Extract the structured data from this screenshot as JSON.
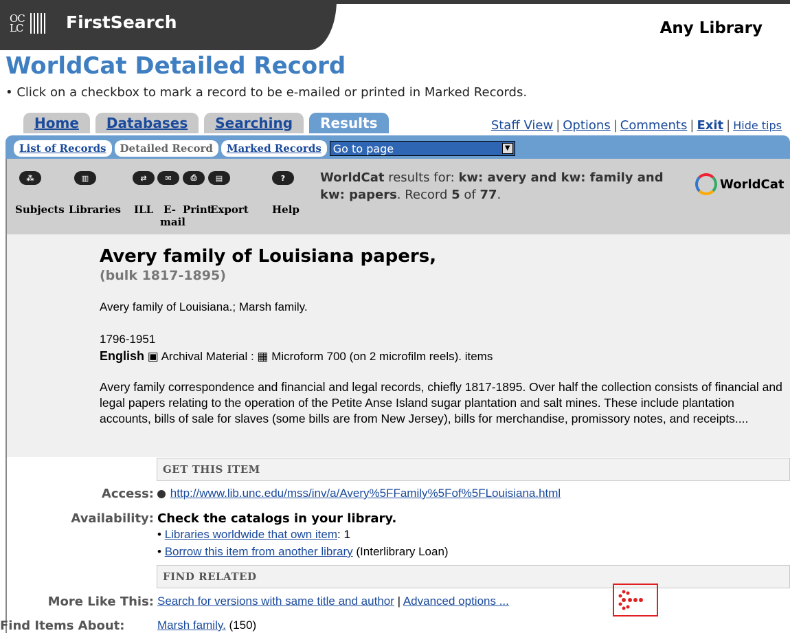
{
  "header": {
    "logo_letters": "OC LC",
    "app_name": "FirstSearch",
    "library": "Any Library"
  },
  "page": {
    "title": "WorldCat Detailed Record",
    "tip": "• Click on a checkbox to mark a record to be e-mailed or printed in Marked Records."
  },
  "tabs": [
    "Home",
    "Databases",
    "Searching",
    "Results"
  ],
  "top_links": {
    "staff_view": "Staff View",
    "options": "Options",
    "comments": "Comments",
    "exit": "Exit",
    "hide_tips": "Hide tips"
  },
  "subtabs": {
    "list": "List of Records",
    "detailed": "Detailed Record",
    "marked": "Marked Records",
    "goto": "Go to page"
  },
  "toolbar": {
    "subjects": "Subjects",
    "libraries": "Libraries",
    "ill": "ILL",
    "email": "E-mail",
    "print": "Print",
    "export": "Export",
    "help": "Help",
    "help_glyph": "?"
  },
  "results": {
    "brand": "WorldCat",
    "text1": " results for: ",
    "query": "kw: avery and kw: family and kw: papers",
    "text2": ". Record ",
    "record_num": "5",
    "text3": " of ",
    "total": "77",
    "text4": ".",
    "logo_text": "WorldCat"
  },
  "record": {
    "title": "Avery family of Louisiana papers,",
    "bulk": "(bulk 1817-1895)",
    "authors": "Avery family of Louisiana.;  Marsh family.",
    "date": "1796-1951",
    "language": "English",
    "format": " Archival Material : ",
    "format2": " Microform 700 (on 2 microfilm reels). items",
    "description": "Avery family correspondence and financial and legal records, chiefly 1817-1895. Over half the collection consists of financial and legal papers relating to the operation of the Petite Anse Island sugar plantation and salt mines. These include plantation accounts, bills of sale for slaves (some bills are from New Jersey), bills for merchandise, promissory notes, and receipts...."
  },
  "get_item": {
    "section": "GET THIS ITEM",
    "access_label": "Access:",
    "access_url": "http://www.lib.unc.edu/mss/inv/a/Avery%5FFamily%5Fof%5FLouisiana.html",
    "availability_label": "Availability:",
    "availability_text": "Check the catalogs in your library.",
    "libraries_link": "Libraries worldwide that own item",
    "libraries_count": ": 1",
    "borrow_link": "Borrow this item from another library",
    "borrow_note": " (Interlibrary Loan)"
  },
  "find_related": {
    "section": "FIND RELATED",
    "more_label": "More Like This:",
    "more_link1": "Search for versions with same title and author",
    "sep": " | ",
    "more_link2": "Advanced options ...",
    "items_label": "Find Items About:",
    "items_link": "Marsh family.",
    "items_count": " (150)"
  }
}
